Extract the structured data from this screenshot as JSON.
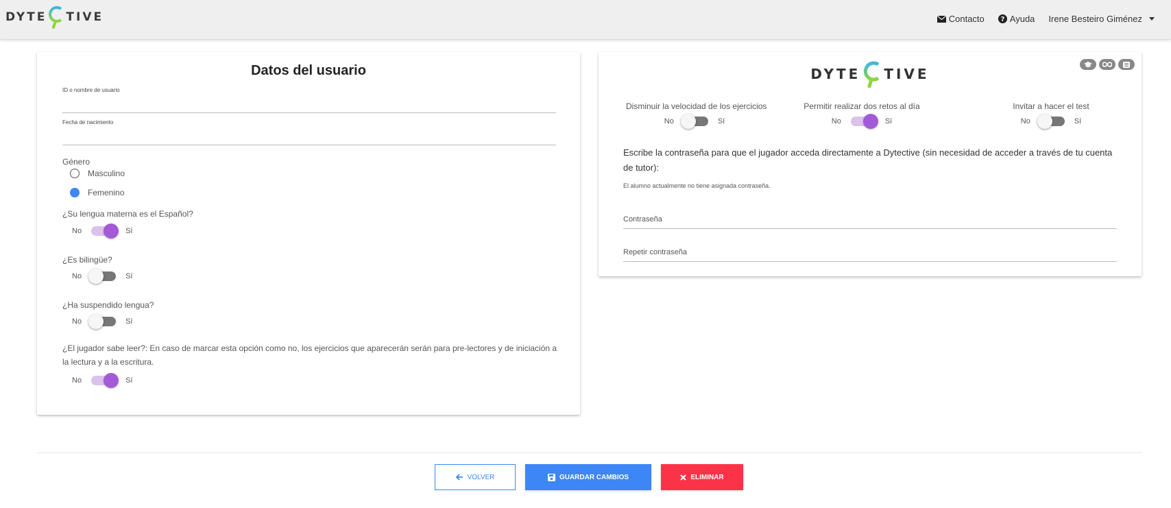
{
  "brand": {
    "prefix": "DYTE",
    "suffix": "TIVE"
  },
  "nav": {
    "contact": "Contacto",
    "help": "Ayuda",
    "user": "Irene Besteiro Giménez"
  },
  "left": {
    "title": "Datos del usuario",
    "id_label": "ID o nombre de usuario",
    "birth_label": "Fecha de nacimiento",
    "gender_label": "Género",
    "gender_options": [
      "Masculino",
      "Femenino"
    ],
    "gender_selected": "Femenino",
    "toggle_no": "No",
    "toggle_yes": "Sí",
    "q_spanish": "¿Su lengua materna es el Español?",
    "q_spanish_on": true,
    "q_bilingual": "¿Es bilingüe?",
    "q_bilingual_on": false,
    "q_failed": "¿Ha suspendido lengua?",
    "q_failed_on": false,
    "q_reads": "¿El jugador sabe leer?: En caso de marcar esta opción como no, los ejercicios que aparecerán serán para pre-lectores y de iniciación a la lectura y a la escritura.",
    "q_reads_on": true
  },
  "right": {
    "setting_speed": "Disminuir la velocidad de los ejercicios",
    "setting_speed_on": false,
    "setting_two": "Permitir realizar dos retos al día",
    "setting_two_on": true,
    "setting_test": "Invitar a hacer el test",
    "setting_test_on": false,
    "pw_desc": "Escribe la contraseña para que el jugador acceda directamente a Dytective (sin necesidad de acceder a través de tu cuenta de tutor):",
    "pw_note": "El alumno actualmente no tiene asignada contraseña.",
    "pw_label": "Contraseña",
    "pw_repeat_label": "Repetir contraseña",
    "icons": [
      "graduation-cap-icon",
      "infinity-icon",
      "list-icon"
    ]
  },
  "footer": {
    "back": "VOLVER",
    "save": "GUARDAR CAMBIOS",
    "delete": "ELIMINAR"
  },
  "colors": {
    "primary": "#3d86f5",
    "danger": "#fb3348",
    "toggle_on": "#a35ad6",
    "logo_green": "#8ed63a",
    "logo_cyan": "#3ab6e3"
  }
}
